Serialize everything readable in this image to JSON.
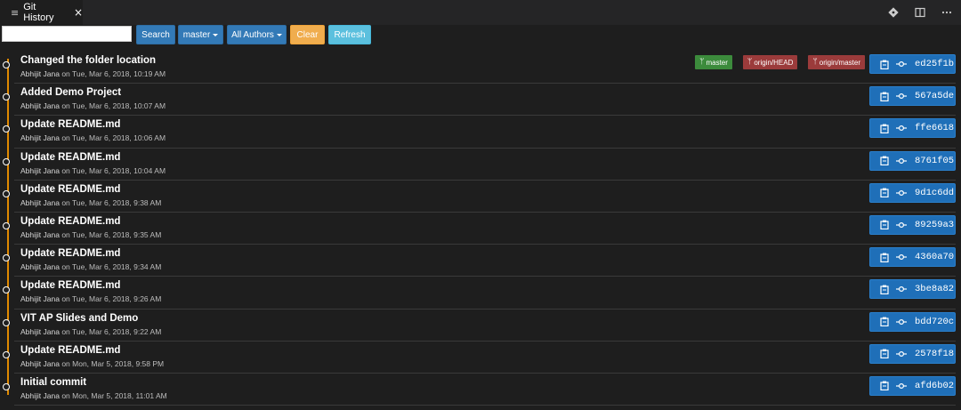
{
  "tab": {
    "icon": "list-icon",
    "title": "Git History",
    "close": "×"
  },
  "actions": [
    {
      "name": "git-compare-icon"
    },
    {
      "name": "split-editor-icon"
    },
    {
      "name": "more-actions-icon"
    }
  ],
  "toolbar": {
    "search_placeholder": "",
    "search_label": "Search",
    "branch_label": "master",
    "authors_label": "All Authors",
    "clear_label": "Clear",
    "refresh_label": "Refresh"
  },
  "colors": {
    "accent": "#337ab7",
    "timeline": "#e08a00",
    "sha_button": "#1f6fb8",
    "branch_local": "#3c8b3c",
    "branch_remote": "#9b3b3b"
  },
  "commits": [
    {
      "message": "Changed the folder location",
      "author": "Abhijit Jana",
      "date": " on Tue, Mar 6, 2018, 10:19 AM",
      "sha": "ed25f1b",
      "refs": [
        {
          "label": "master",
          "type": "local"
        },
        {
          "label": "origin/HEAD",
          "type": "remote"
        },
        {
          "label": "origin/master",
          "type": "remote"
        }
      ]
    },
    {
      "message": "Added Demo Project",
      "author": "Abhijit Jana",
      "date": " on Tue, Mar 6, 2018, 10:07 AM",
      "sha": "567a5de",
      "refs": []
    },
    {
      "message": "Update README.md",
      "author": "Abhijit Jana",
      "date": " on Tue, Mar 6, 2018, 10:06 AM",
      "sha": "ffe6618",
      "refs": []
    },
    {
      "message": "Update README.md",
      "author": "Abhijit Jana",
      "date": " on Tue, Mar 6, 2018, 10:04 AM",
      "sha": "8761f05",
      "refs": []
    },
    {
      "message": "Update README.md",
      "author": "Abhijit Jana",
      "date": " on Tue, Mar 6, 2018, 9:38 AM",
      "sha": "9d1c6dd",
      "refs": []
    },
    {
      "message": "Update README.md",
      "author": "Abhijit Jana",
      "date": " on Tue, Mar 6, 2018, 9:35 AM",
      "sha": "89259a3",
      "refs": []
    },
    {
      "message": "Update README.md",
      "author": "Abhijit Jana",
      "date": " on Tue, Mar 6, 2018, 9:34 AM",
      "sha": "4360a70",
      "refs": []
    },
    {
      "message": "Update README.md",
      "author": "Abhijit Jana",
      "date": " on Tue, Mar 6, 2018, 9:26 AM",
      "sha": "3be8a82",
      "refs": []
    },
    {
      "message": "VIT AP Slides and Demo",
      "author": "Abhijit Jana",
      "date": " on Tue, Mar 6, 2018, 9:22 AM",
      "sha": "bdd720c",
      "refs": []
    },
    {
      "message": "Update README.md",
      "author": "Abhijit Jana",
      "date": " on Mon, Mar 5, 2018, 9:58 PM",
      "sha": "2578f18",
      "refs": []
    },
    {
      "message": "Initial commit",
      "author": "Abhijit Jana",
      "date": " on Mon, Mar 5, 2018, 11:01 AM",
      "sha": "afd6b02",
      "refs": []
    }
  ]
}
